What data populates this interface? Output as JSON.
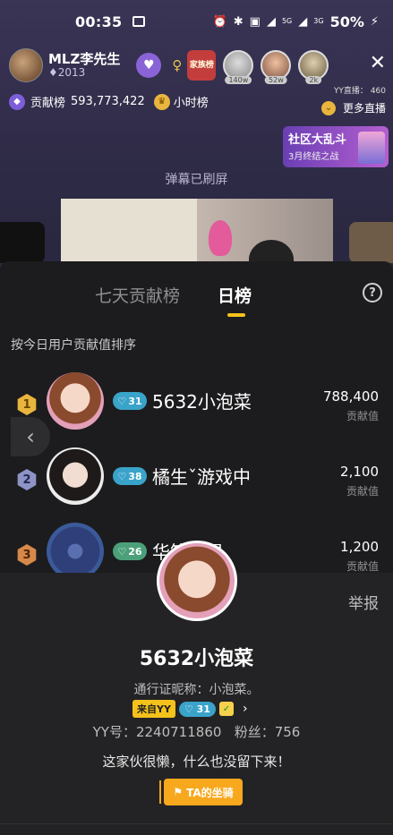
{
  "status_bar": {
    "time": "00:35",
    "signal_labels": [
      "5G",
      "3G"
    ],
    "battery": "50%"
  },
  "live_header": {
    "host_name": "MLZ李先生",
    "host_id": "2013",
    "family_badge": "家族榜",
    "viewer_counts": [
      "140w",
      "52w",
      "2k"
    ],
    "yy_live_label": "YY直播：",
    "yy_live_id": "460"
  },
  "contrib_row": {
    "contribution_label": "贡献榜",
    "contribution_value": "593,773,422",
    "hourly_label": "小时榜",
    "more_live": "更多直播"
  },
  "community_banner": {
    "title": "社区大乱斗",
    "subtitle": "3月终结之战"
  },
  "barrage_notice": "弹幕已刷屏",
  "ranking": {
    "tab_week": "七天贡献榜",
    "tab_day": "日榜",
    "sort_hint": "按今日用户贡献值排序",
    "score_unit": "贡献值",
    "rows": [
      {
        "rank": "1",
        "name": "5632小泡菜",
        "level": "31",
        "score": "788,400",
        "hex_color": "#e9b53d",
        "level_color": "#3aa3c9"
      },
      {
        "rank": "2",
        "name": "橘生ˇ游戏中",
        "level": "38",
        "score": "2,100",
        "hex_color": "#8e93c6",
        "level_color": "#3aa3c9"
      },
      {
        "rank": "3",
        "name": "华笙…昊",
        "level": "26",
        "score": "1,200",
        "hex_color": "#d6894a",
        "level_color": "#4ba07a"
      }
    ]
  },
  "profile_card": {
    "report": "举报",
    "name": "5632小泡菜",
    "nickname": "通行证昵称：小泡菜。",
    "from_tag": "来自YY",
    "level": "31",
    "ids": "YY号：2240711860   粉丝：756",
    "bio": "这家伙很懒，什么也没留下来！",
    "seat_button": "TA的坐骑"
  }
}
